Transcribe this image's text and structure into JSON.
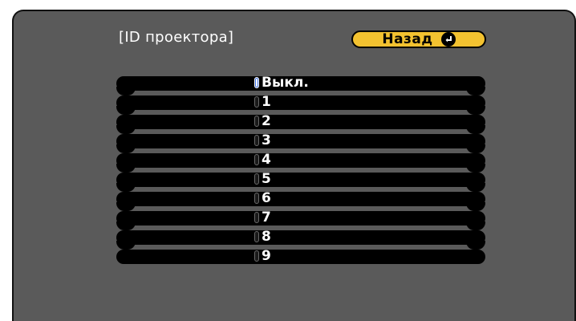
{
  "dialog": {
    "title": "[ID проектора]",
    "back_label": "Назад",
    "back_icon": "enter-return-icon"
  },
  "options": [
    {
      "label": "Выкл.",
      "selected": true
    },
    {
      "label": "1",
      "selected": false
    },
    {
      "label": "2",
      "selected": false
    },
    {
      "label": "3",
      "selected": false
    },
    {
      "label": "4",
      "selected": false
    },
    {
      "label": "5",
      "selected": false
    },
    {
      "label": "6",
      "selected": false
    },
    {
      "label": "7",
      "selected": false
    },
    {
      "label": "8",
      "selected": false
    },
    {
      "label": "9",
      "selected": false
    }
  ],
  "colors": {
    "panel_background": "#5a5a5a",
    "row_background": "#000000",
    "button_accent": "#f3c230",
    "text": "#ffffff"
  }
}
